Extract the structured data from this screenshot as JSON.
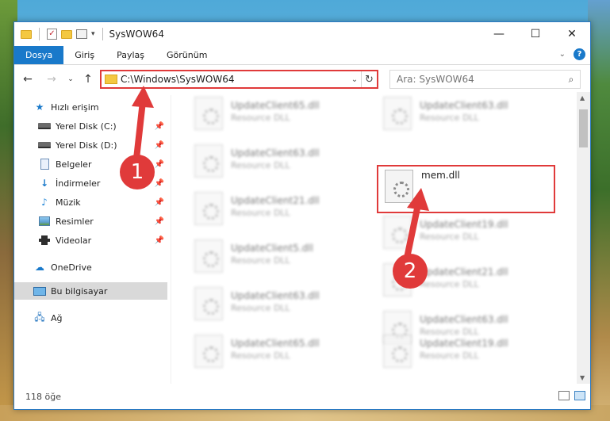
{
  "window": {
    "title": "SysWOW64",
    "controls": {
      "minimize": "—",
      "maximize": "☐",
      "close": "✕"
    }
  },
  "ribbon": {
    "tabs": [
      {
        "label": "Dosya",
        "active": true
      },
      {
        "label": "Giriş"
      },
      {
        "label": "Paylaş"
      },
      {
        "label": "Görünüm"
      }
    ],
    "help": "?"
  },
  "nav": {
    "address": "C:\\Windows\\SysWOW64",
    "search_placeholder": "Ara: SysWOW64"
  },
  "sidebar": {
    "items": [
      {
        "label": "Hızlı erişim",
        "icon": "star-icon"
      },
      {
        "label": "Yerel Disk (C:)",
        "icon": "drive-icon",
        "pinned": true
      },
      {
        "label": "Yerel Disk (D:)",
        "icon": "drive-icon",
        "pinned": true
      },
      {
        "label": "Belgeler",
        "icon": "document-icon",
        "pinned": true
      },
      {
        "label": "İndirmeler",
        "icon": "download-icon",
        "pinned": true
      },
      {
        "label": "Müzik",
        "icon": "music-icon",
        "pinned": true
      },
      {
        "label": "Resimler",
        "icon": "pictures-icon",
        "pinned": true
      },
      {
        "label": "Videolar",
        "icon": "video-icon",
        "pinned": true
      },
      {
        "label": "OneDrive",
        "icon": "cloud-icon"
      },
      {
        "label": "Bu bilgisayar",
        "icon": "computer-icon",
        "selected": true
      },
      {
        "label": "Ağ",
        "icon": "network-icon"
      }
    ]
  },
  "files": [
    {
      "name": "UpdateClient65.dll",
      "type": "Resource DLL"
    },
    {
      "name": "UpdateClient63.dll",
      "type": "Resource DLL"
    },
    {
      "name": "UpdateClient63.dll",
      "type": "Resource DLL"
    },
    {
      "name": "mem.dll",
      "type": "",
      "highlighted": true
    },
    {
      "name": "UpdateClient21.dll",
      "type": "Resource DLL"
    },
    {
      "name": "UpdateClient19.dll",
      "type": "Resource DLL"
    },
    {
      "name": "UpdateClient5.dll",
      "type": "Resource DLL"
    },
    {
      "name": "UpdateClient21.dll",
      "type": "Resource DLL"
    },
    {
      "name": "UpdateClient63.dll",
      "type": "Resource DLL"
    },
    {
      "name": "UpdateClient63.dll",
      "type": "Resource DLL"
    },
    {
      "name": "UpdateClient65.dll",
      "type": "Resource DLL"
    },
    {
      "name": "UpdateClient19.dll",
      "type": "Resource DLL"
    }
  ],
  "status": {
    "count": "118 öğe"
  },
  "annotations": [
    {
      "label": "1"
    },
    {
      "label": "2"
    }
  ],
  "colors": {
    "accent": "#1979ca",
    "highlight": "#e03a3a"
  }
}
